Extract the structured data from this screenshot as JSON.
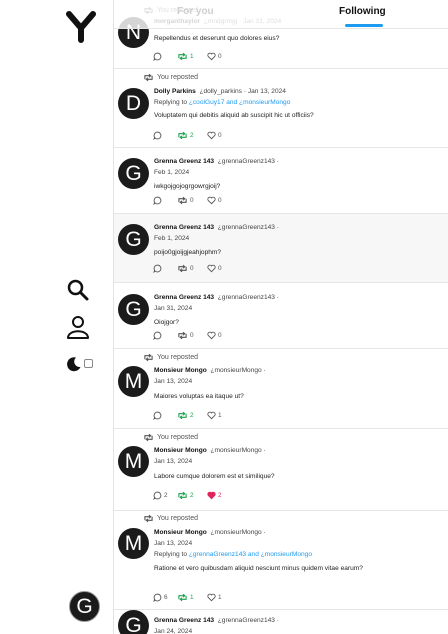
{
  "header": {
    "tabs": [
      {
        "label": "For you"
      },
      {
        "label": "Following"
      }
    ]
  },
  "sidebar": {
    "logo_text": "Y",
    "me_avatar_letter": "G"
  },
  "labels": {
    "reposted": "You reposted"
  },
  "posts": [
    {
      "avatar_letter": "N",
      "name": "morganthaylor",
      "handle": "¿mndgrmgj",
      "date": "Jan 31, 2024",
      "body": "Repellendus et deserunt quo dolores eius?",
      "replies": "",
      "reposts": "1",
      "likes": "0",
      "reposted_by_me": true
    },
    {
      "avatar_letter": "D",
      "name": "Dolly Parkins",
      "handle": "¿dolly_parkins",
      "date": "Jan 13, 2024",
      "reply_prefix": "Replying to",
      "reply_mentions": "¿coolGuy17 and ¿monsieurMongo",
      "body": "Voluptatem qui debitis aliquid ab suscipit hic ut officiis?",
      "replies": "",
      "reposts": "2",
      "likes": "0",
      "reposted_by_me": true
    },
    {
      "avatar_letter": "G",
      "name": "Grenna Greenz 143",
      "handle": "¿grennaGreenz143",
      "date": "Feb 1, 2024",
      "body": "iwkgojgojogrgowrgjoij?",
      "replies": "",
      "reposts": "0",
      "likes": "0",
      "reposted_by_me": false
    },
    {
      "avatar_letter": "G",
      "name": "Grenna Greenz 143",
      "handle": "¿grennaGreenz143",
      "date": "Feb 1, 2024",
      "body": "poijo0gjoijgjeahjophm?",
      "replies": "",
      "reposts": "0",
      "likes": "0",
      "reposted_by_me": false
    },
    {
      "avatar_letter": "G",
      "name": "Grenna Greenz 143",
      "handle": "¿grennaGreenz143",
      "date": "Jan 31, 2024",
      "body": "Oiojgor?",
      "replies": "",
      "reposts": "0",
      "likes": "0",
      "reposted_by_me": false
    },
    {
      "avatar_letter": "M",
      "name": "Monsieur Mongo",
      "handle": "¿monsieurMongo",
      "date": "Jan 13, 2024",
      "body": "Maiores voluptas ea itaque ut?",
      "replies": "",
      "reposts": "2",
      "likes": "1",
      "reposted_by_me": true
    },
    {
      "avatar_letter": "M",
      "name": "Monsieur Mongo",
      "handle": "¿monsieurMongo",
      "date": "Jan 13, 2024",
      "body": "Labore cumque dolorem est et similique?",
      "replies": "2",
      "reposts": "2",
      "likes": "2",
      "reposted_by_me": true,
      "liked_by_me": true
    },
    {
      "avatar_letter": "M",
      "name": "Monsieur Mongo",
      "handle": "¿monsieurMongo",
      "date": "Jan 13, 2024",
      "reply_prefix": "Replying to",
      "reply_mentions": "¿grennaGreenz143 and ¿monsieurMongo",
      "body": "Ratione et vero quibusdam aliquid nesciunt minus quidem vitae earum?",
      "replies": "6",
      "reposts": "1",
      "likes": "1",
      "reposted_by_me": true
    },
    {
      "avatar_letter": "G",
      "name": "Grenna Greenz 143",
      "handle": "¿grennaGreenz143",
      "date": "Jan 24, 2024",
      "body": "",
      "replies": "",
      "reposts": "",
      "likes": "",
      "reposted_by_me": false
    }
  ],
  "colors": {
    "accent": "#1d9bf0",
    "repost_active": "#1aa24a",
    "like_active": "#e0245e"
  }
}
